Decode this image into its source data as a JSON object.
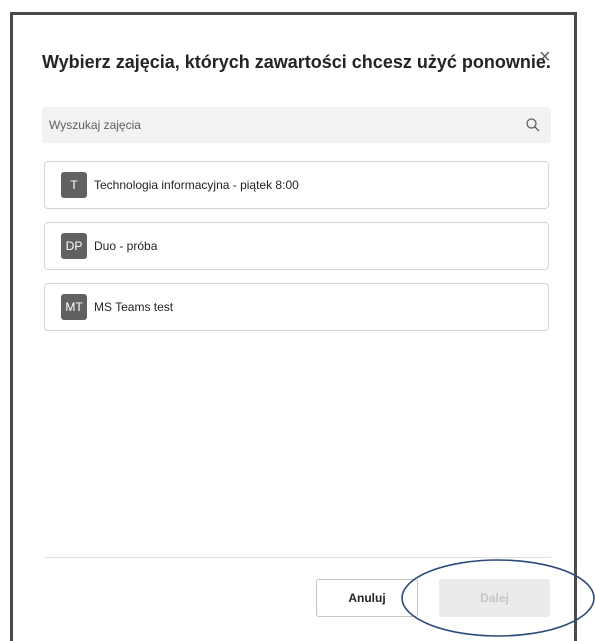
{
  "dialog": {
    "title": "Wybierz zajęcia, których zawartości chcesz użyć ponownie.",
    "close_glyph": "×"
  },
  "search": {
    "placeholder": "Wyszukaj zajęcia",
    "icon": "search-icon"
  },
  "classes": [
    {
      "initials": "T",
      "name": "Technologia informacyjna - piątek 8:00"
    },
    {
      "initials": "DP",
      "name": "Duo - próba"
    },
    {
      "initials": "MT",
      "name": "MS Teams test"
    }
  ],
  "footer": {
    "cancel_label": "Anuluj",
    "next_label": "Dalej",
    "next_enabled": false
  },
  "colors": {
    "avatar_bg": "#616161",
    "annotation_stroke": "#2e4a7a",
    "disabled_button_bg": "#edebe9"
  }
}
